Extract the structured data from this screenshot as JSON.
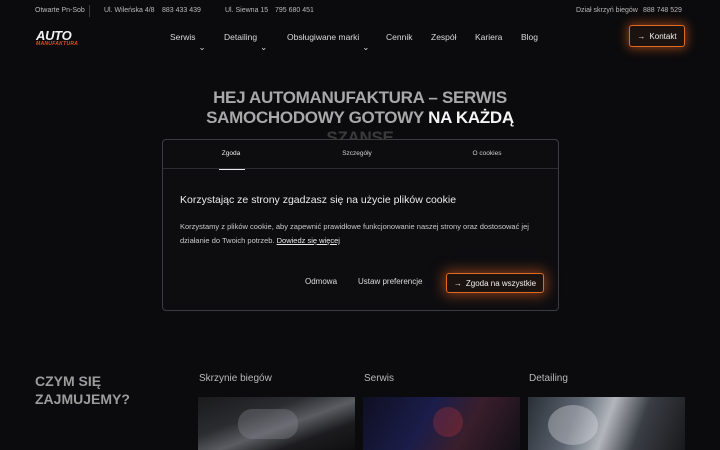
{
  "topbar": {
    "hours": "Otwarte Pn-Sob",
    "address1": "Ul. Wileńska 4/8",
    "phone1": "883 433 439",
    "address2": "Ul. Siewna 15",
    "phone2": "795 680 451",
    "dept_label": "Dział skrzyń biegów",
    "dept_phone": "888 748 529"
  },
  "header": {
    "logo_top": "AUTO",
    "logo_bottom": "MANUFAKTURA",
    "nav": [
      {
        "label": "Serwis",
        "dropdown": true
      },
      {
        "label": "Detailing",
        "dropdown": true
      },
      {
        "label": "Obsługiwane marki",
        "dropdown": true
      },
      {
        "label": "Cennik",
        "dropdown": false
      },
      {
        "label": "Zespół",
        "dropdown": false
      },
      {
        "label": "Kariera",
        "dropdown": false
      },
      {
        "label": "Blog",
        "dropdown": false
      }
    ],
    "contact_label": "Kontakt"
  },
  "hero": {
    "line1_a": "HEJ AUTOMANUFAKTURA – SERWIS",
    "line2_a": "SAMOCHODOWY GOTOWY",
    "line2_b": "NA KAŻDĄ",
    "line3": "SZANSĘ"
  },
  "cookie": {
    "tabs": [
      "Zgoda",
      "Szczegóły",
      "O cookies"
    ],
    "active_tab": 0,
    "title": "Korzystając ze strony zgadzasz się na użycie plików cookie",
    "body": "Korzystamy z plików cookie, aby zapewnić prawidłowe funkcjonowanie naszej strony oraz dostosować jej działanie do Twoich potrzeb.",
    "link": "Dowiedz się więcej",
    "decline": "Odmowa",
    "preferences": "Ustaw preferencje",
    "accept": "Zgoda na wszystkie"
  },
  "section": {
    "heading_1": "CZYM SIĘ",
    "heading_2": "ZAJMUJEMY?",
    "cards": [
      {
        "title": "Skrzynie biegów"
      },
      {
        "title": "Serwis"
      },
      {
        "title": "Detailing"
      }
    ]
  },
  "colors": {
    "accent": "#e06a24",
    "background": "#0b0b0d"
  }
}
